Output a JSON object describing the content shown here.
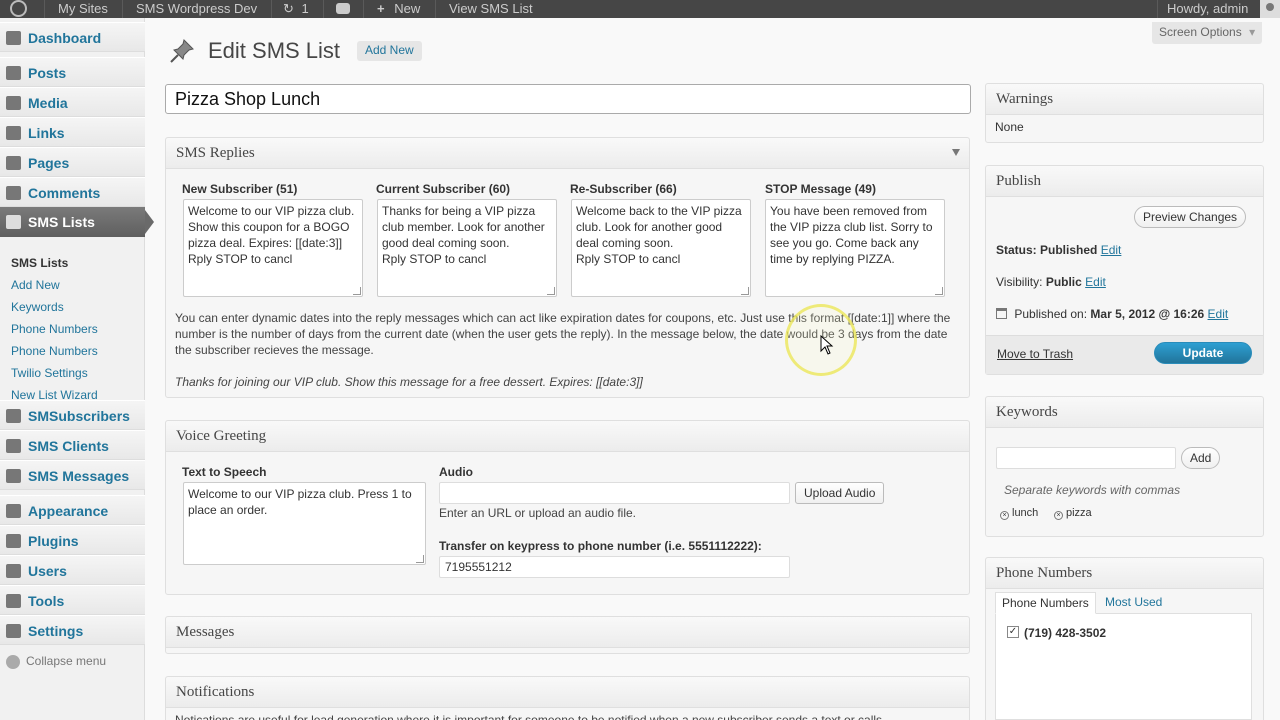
{
  "admin_bar": {
    "my_sites": "My Sites",
    "site_name": "SMS Wordpress Dev",
    "updates_count": "1",
    "new_label": "New",
    "view_label": "View SMS List",
    "howdy": "Howdy, admin"
  },
  "sidebar": {
    "items": [
      {
        "label": "Dashboard",
        "icon": "dashboard-icon"
      },
      {
        "label": "Posts",
        "icon": "posts-icon"
      },
      {
        "label": "Media",
        "icon": "media-icon"
      },
      {
        "label": "Links",
        "icon": "links-icon"
      },
      {
        "label": "Pages",
        "icon": "pages-icon"
      },
      {
        "label": "Comments",
        "icon": "comments-icon"
      },
      {
        "label": "SMS Lists",
        "icon": "sms-lists-icon"
      },
      {
        "label": "SMSubscribers",
        "icon": "subscribers-icon"
      },
      {
        "label": "SMS Clients",
        "icon": "clients-icon"
      },
      {
        "label": "SMS Messages",
        "icon": "messages-icon"
      },
      {
        "label": "Appearance",
        "icon": "appearance-icon"
      },
      {
        "label": "Plugins",
        "icon": "plugins-icon"
      },
      {
        "label": "Users",
        "icon": "users-icon"
      },
      {
        "label": "Tools",
        "icon": "tools-icon"
      },
      {
        "label": "Settings",
        "icon": "settings-icon"
      }
    ],
    "submenu": [
      "SMS Lists",
      "Add New",
      "Keywords",
      "Phone Numbers",
      "Phone Numbers",
      "Twilio Settings",
      "New List Wizard"
    ],
    "collapse": "Collapse menu"
  },
  "header": {
    "title": "Edit SMS List",
    "add_new": "Add New",
    "screen_options": "Screen Options"
  },
  "post_title": "Pizza Shop Lunch",
  "sms_replies": {
    "title": "SMS Replies",
    "columns": [
      {
        "label": "New Subscriber (51)",
        "text": "Welcome to our VIP pizza club. Show this coupon for a BOGO pizza deal. Expires: [[date:3]]\nRply STOP to cancl"
      },
      {
        "label": "Current Subscriber (60)",
        "text": "Thanks for being a VIP pizza club member. Look for another good deal coming soon.\nRply STOP to cancl"
      },
      {
        "label": "Re-Subscriber (66)",
        "text": "Welcome back to the VIP pizza club. Look for another good deal coming soon.\nRply STOP to cancl"
      },
      {
        "label": "STOP Message (49)",
        "text": "You have been removed from the VIP pizza club list. Sorry to see you go. Come back any time by replying PIZZA."
      }
    ],
    "description": "You can enter dynamic dates into the reply messages which can act like expiration dates for coupons, etc. Just use this format [[date:1]] where the number is the number of days from the current date (when the user gets the reply). In the message below, the date would be 3 days from the date the subscriber recieves the message.",
    "example": "Thanks for joining our VIP club. Show this message for a free dessert. Expires: [[date:3]]"
  },
  "voice_greeting": {
    "title": "Voice Greeting",
    "tts_label": "Text to Speech",
    "tts_text": "Welcome to our VIP pizza club. Press 1 to place an order.",
    "audio_label": "Audio",
    "audio_value": "",
    "upload_button": "Upload Audio",
    "audio_hint": "Enter an URL or upload an audio file.",
    "transfer_label": "Transfer on keypress to phone number (i.e. 5551112222):",
    "transfer_value": "7195551212"
  },
  "messages": {
    "title": "Messages"
  },
  "notifications": {
    "title": "Notifications",
    "text": "Notications are useful for lead generation where it is important for someone to be notified when a new subscriber sends a text or calls"
  },
  "warnings": {
    "title": "Warnings",
    "text": "None"
  },
  "publish": {
    "title": "Publish",
    "preview": "Preview Changes",
    "status_label": "Status:",
    "status_value": "Published",
    "visibility_label": "Visibility:",
    "visibility_value": "Public",
    "published_label": "Published on:",
    "published_value": "Mar 5, 2012 @ 16:26",
    "edit": "Edit",
    "trash": "Move to Trash",
    "update": "Update"
  },
  "keywords": {
    "title": "Keywords",
    "input_value": "",
    "add_button": "Add",
    "hint": "Separate keywords with commas",
    "tags": [
      "lunch",
      "pizza"
    ]
  },
  "phone_numbers": {
    "title": "Phone Numbers",
    "tabs": [
      "Phone Numbers",
      "Most Used"
    ],
    "items": [
      {
        "number": "(719) 428-3502",
        "checked": true
      }
    ]
  }
}
